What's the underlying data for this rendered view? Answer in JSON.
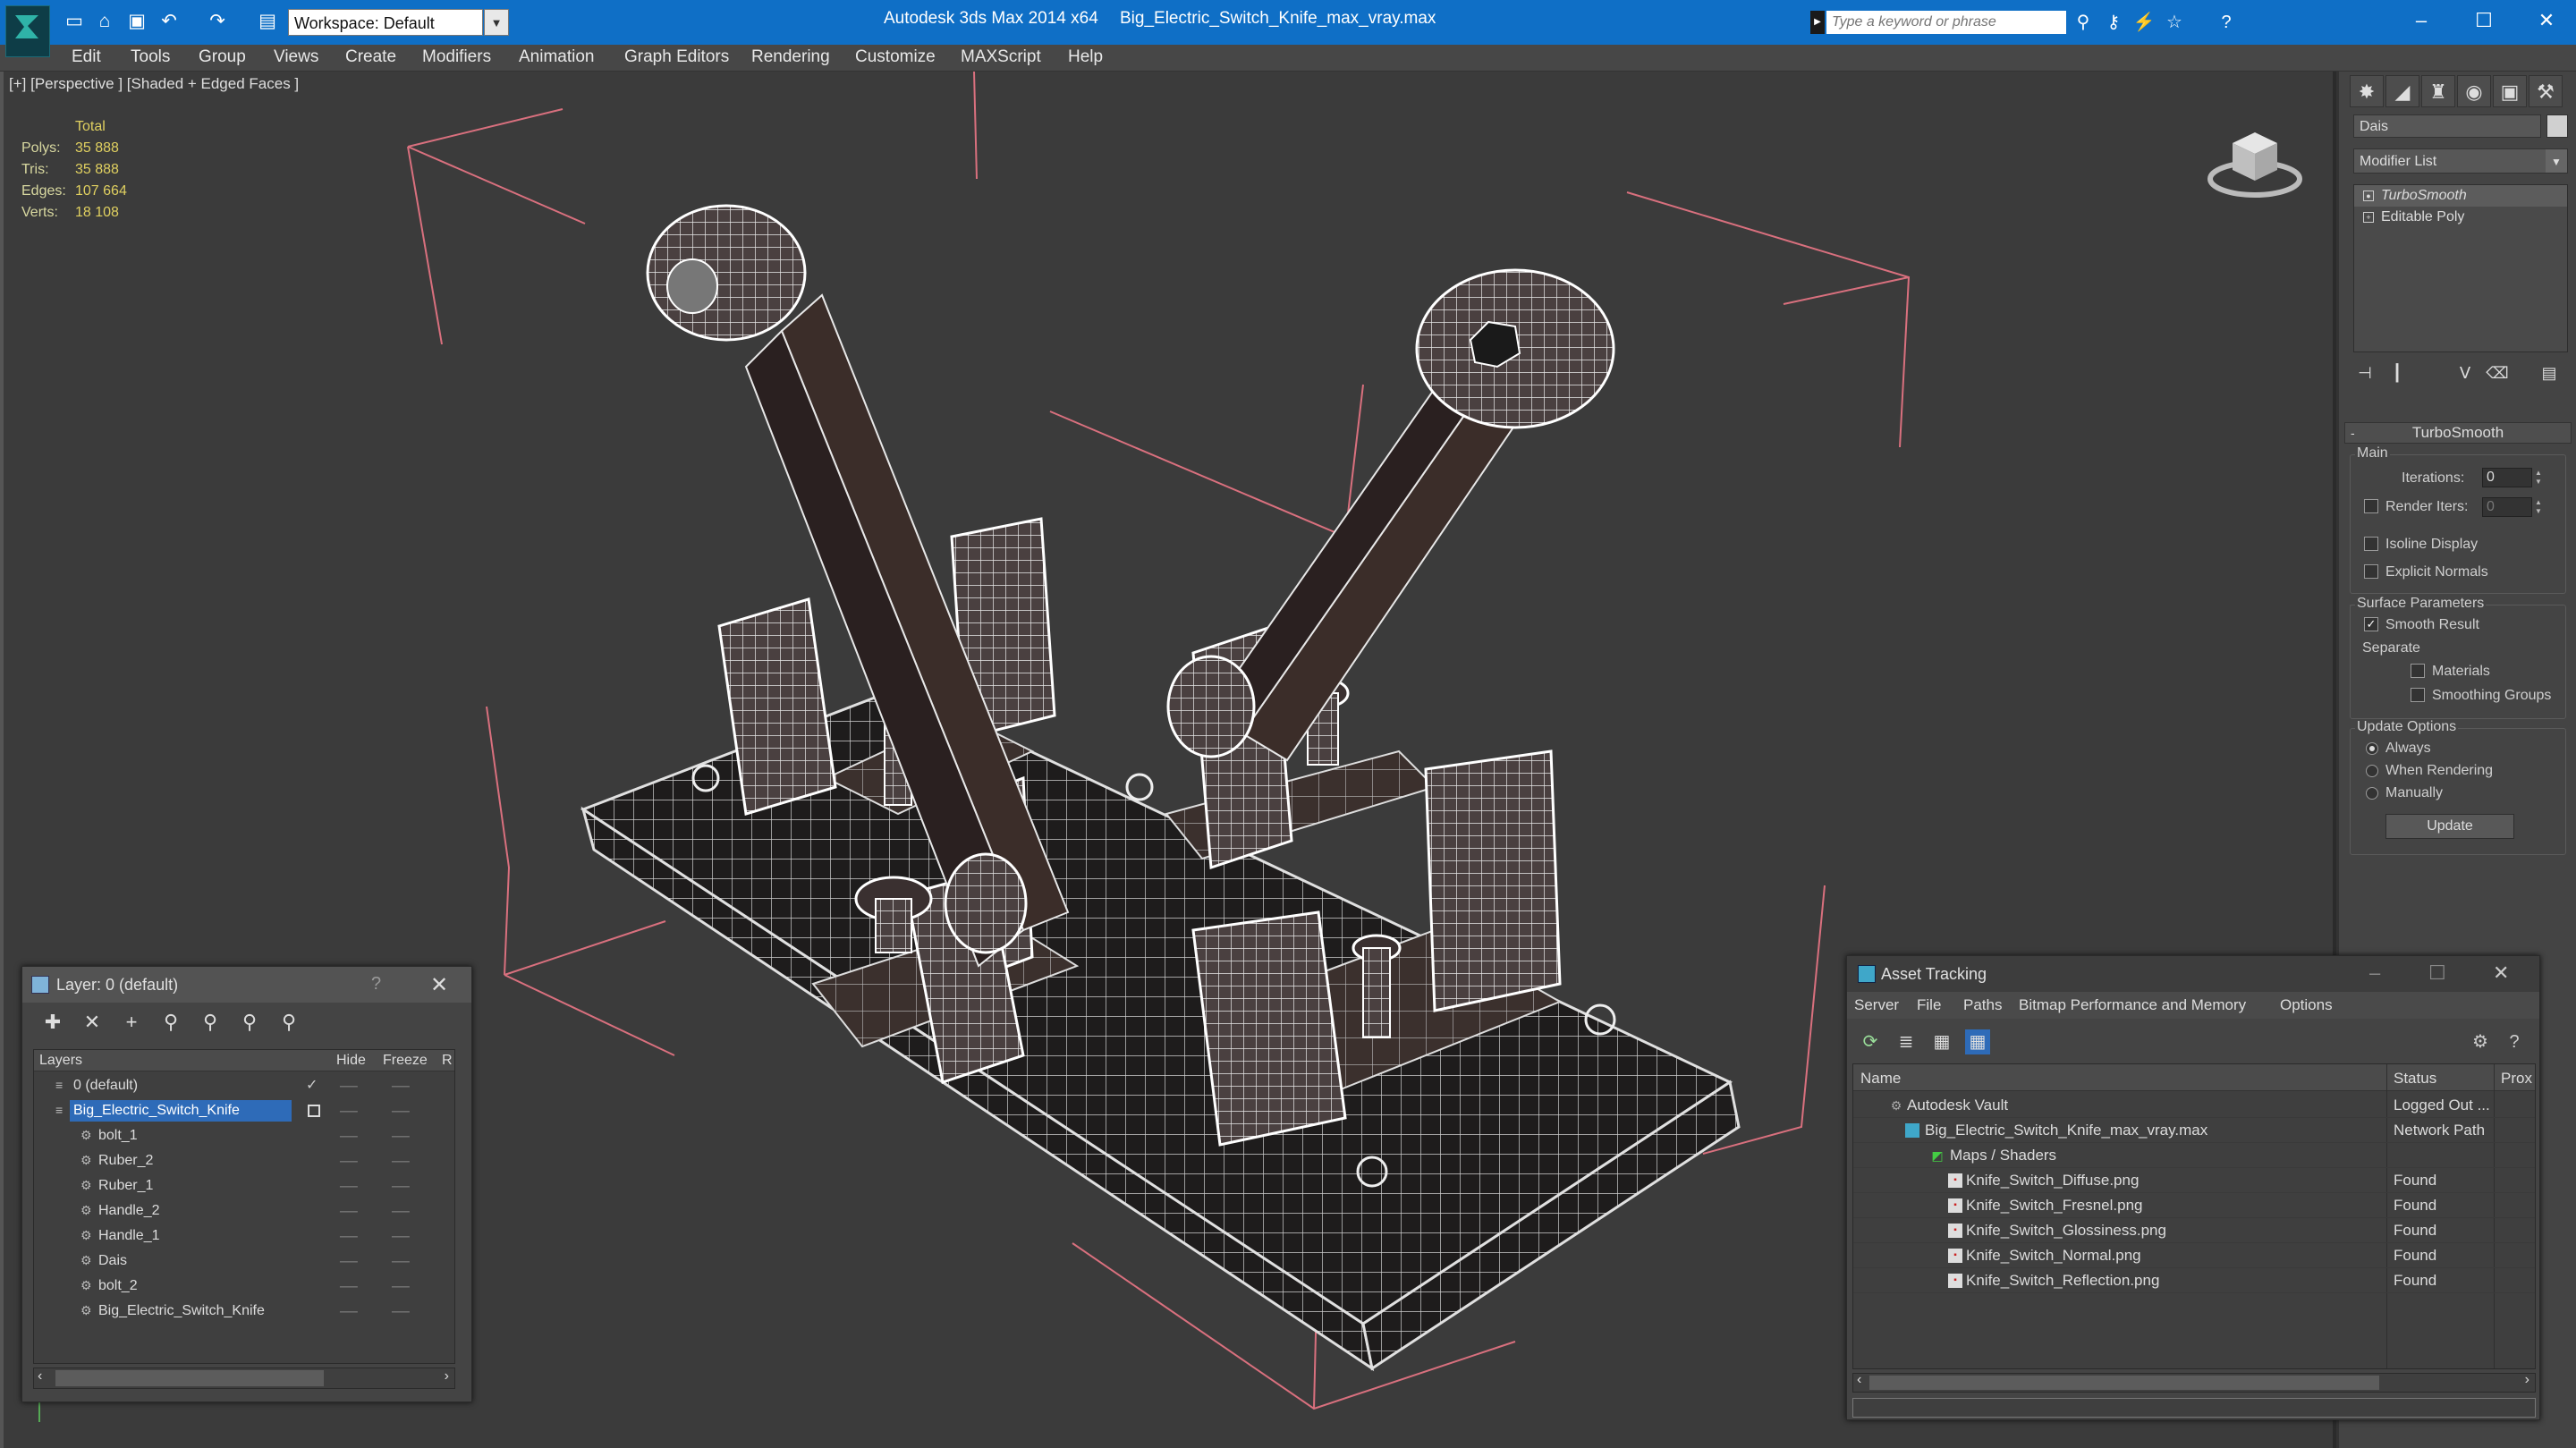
{
  "titlebar": {
    "workspace_label": "Workspace: Default",
    "app_title": "Autodesk 3ds Max  2014 x64",
    "file_title": "Big_Electric_Switch_Knife_max_vray.max",
    "search_placeholder": "Type a keyword or phrase"
  },
  "menu": [
    "Edit",
    "Tools",
    "Group",
    "Views",
    "Create",
    "Modifiers",
    "Animation",
    "Graph Editors",
    "Rendering",
    "Customize",
    "MAXScript",
    "Help"
  ],
  "viewport": {
    "label": "[+] [Perspective ] [Shaded + Edged Faces ]",
    "stats": {
      "header": "Total",
      "rows": [
        {
          "key": "Polys:",
          "value": "35 888"
        },
        {
          "key": "Tris:",
          "value": "35 888"
        },
        {
          "key": "Edges:",
          "value": "107 664"
        },
        {
          "key": "Verts:",
          "value": "18 108"
        }
      ]
    }
  },
  "command_panel": {
    "object_name": "Dais",
    "modifier_list": "Modifier List",
    "stack": [
      "TurboSmooth",
      "Editable Poly"
    ],
    "rollout_title": "TurboSmooth",
    "main_group": "Main",
    "iterations_label": "Iterations:",
    "iterations_value": "0",
    "render_iters_label": "Render Iters:",
    "render_iters_value": "0",
    "isoline_display": "Isoline Display",
    "explicit_normals": "Explicit Normals",
    "surface_group": "Surface Parameters",
    "smooth_result": "Smooth Result",
    "separate_label": "Separate",
    "materials": "Materials",
    "smoothing_groups": "Smoothing Groups",
    "update_group": "Update Options",
    "always": "Always",
    "when_rendering": "When Rendering",
    "manually": "Manually",
    "update_button": "Update"
  },
  "layer_window": {
    "title": "Layer: 0 (default)",
    "help": "?",
    "columns": {
      "layers": "Layers",
      "hide": "Hide",
      "freeze": "Freeze",
      "r": "R"
    },
    "rows": [
      {
        "name": "0 (default)"
      },
      {
        "name": "Big_Electric_Switch_Knife"
      },
      {
        "name": "bolt_1"
      },
      {
        "name": "Ruber_2"
      },
      {
        "name": "Ruber_1"
      },
      {
        "name": "Handle_2"
      },
      {
        "name": "Handle_1"
      },
      {
        "name": "Dais"
      },
      {
        "name": "bolt_2"
      },
      {
        "name": "Big_Electric_Switch_Knife"
      }
    ]
  },
  "asset_window": {
    "title": "Asset Tracking",
    "menu": [
      "Server",
      "File",
      "Paths",
      "Bitmap Performance and Memory",
      "Options"
    ],
    "columns": {
      "name": "Name",
      "status": "Status",
      "proxy": "Prox"
    },
    "rows": [
      {
        "name": "Autodesk Vault",
        "status": "Logged Out ..."
      },
      {
        "name": "Big_Electric_Switch_Knife_max_vray.max",
        "status": "Network Path"
      },
      {
        "name": "Maps / Shaders",
        "status": ""
      },
      {
        "name": "Knife_Switch_Diffuse.png",
        "status": "Found"
      },
      {
        "name": "Knife_Switch_Fresnel.png",
        "status": "Found"
      },
      {
        "name": "Knife_Switch_Glossiness.png",
        "status": "Found"
      },
      {
        "name": "Knife_Switch_Normal.png",
        "status": "Found"
      },
      {
        "name": "Knife_Switch_Reflection.png",
        "status": "Found"
      }
    ]
  },
  "colors": {
    "titlebar": "#0f6fc6",
    "selection": "#2e6bb8",
    "stats_text": "#e0d060",
    "bbox_lines": "#d9707e"
  }
}
